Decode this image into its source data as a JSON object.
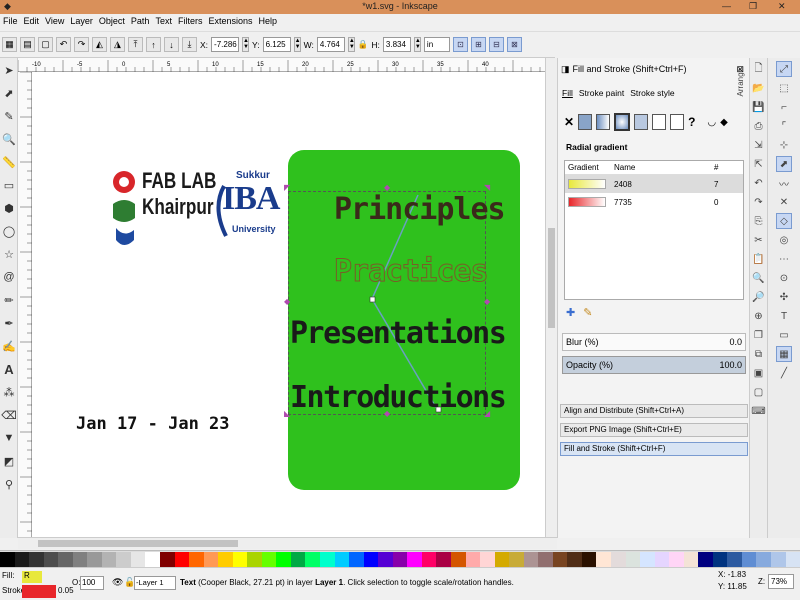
{
  "window": {
    "title": "*w1.svg - Inkscape",
    "minimize": "—",
    "maximize": "❐",
    "close": "✕"
  },
  "menu": [
    "File",
    "Edit",
    "View",
    "Layer",
    "Object",
    "Path",
    "Text",
    "Filters",
    "Extensions",
    "Help"
  ],
  "toolctrl": {
    "x_label": "X:",
    "x": "-7.286",
    "y_label": "Y:",
    "y": "6.125",
    "w_label": "W:",
    "w": "4.764",
    "h_label": "H:",
    "h": "3.834",
    "unit": "in"
  },
  "ruler_ticks": [
    "-10",
    "-5",
    "0",
    "5",
    "10",
    "15",
    "20",
    "25",
    "30",
    "35",
    "40"
  ],
  "canvas": {
    "fablab_line1": "FAB LAB",
    "fablab_line2": "Khairpur",
    "iba_top": "Sukkur",
    "iba_main": "IBA",
    "iba_bottom": "University",
    "date": "Jan 17 - Jan 23",
    "lines": [
      "Principles",
      "Practices",
      "Presentations",
      "Introductions"
    ],
    "box_color": "#2fc11d"
  },
  "dock": {
    "title": "Fill and Stroke (Shift+Ctrl+F)",
    "tabs": [
      "Fill",
      "Stroke paint",
      "Stroke style"
    ],
    "paint_x": "✕",
    "paint_unknown": "?",
    "gradient_type": "Radial gradient",
    "gradient_header_gradient": "Gradient",
    "gradient_header_name": "Name",
    "gradient_header_count": "#",
    "gradients": [
      {
        "name": "2408",
        "count": "7",
        "color": "#e8e83c"
      },
      {
        "name": "7735",
        "count": "0",
        "color": "#e8262a"
      }
    ],
    "blur_label": "Blur (%)",
    "blur_value": "0.0",
    "opacity_label": "Opacity (%)",
    "opacity_value": "100.0",
    "panels": [
      "Align and Distribute (Shift+Ctrl+A)",
      "Export PNG Image (Shift+Ctrl+E)",
      "Fill and Stroke (Shift+Ctrl+F)"
    ],
    "arrange": "Arrange"
  },
  "status": {
    "fill_label": "Fill:",
    "fill_value": "R",
    "stroke_label": "Stroke:",
    "stroke_value": "0.05",
    "opacity_label": "O:",
    "opacity_value": "100",
    "layer": "-Layer 1",
    "message_type": "Text",
    "message": "(Cooper Black, 27.21 pt) in layer",
    "message_layer": "Layer 1",
    "message_end": ". Click selection to toggle scale/rotation handles.",
    "x_label": "X:",
    "x": "-1.83",
    "y_label": "Y:",
    "y": "11.85",
    "zoom_label": "Z:",
    "zoom": "73%"
  },
  "palette_colors": [
    "#000000",
    "#1a1a1a",
    "#333333",
    "#4d4d4d",
    "#666666",
    "#808080",
    "#999999",
    "#b3b3b3",
    "#cccccc",
    "#e6e6e6",
    "#ffffff",
    "#800000",
    "#ff0000",
    "#ff6600",
    "#ff9955",
    "#ffcc00",
    "#ffff00",
    "#aad400",
    "#66ff00",
    "#00ff00",
    "#00aa44",
    "#00ff66",
    "#00ffcc",
    "#00ccff",
    "#0066ff",
    "#0000ff",
    "#5500d4",
    "#8800aa",
    "#ff00ff",
    "#ff0066",
    "#aa0044",
    "#d45500",
    "#ffaaaa",
    "#ffd5d5",
    "#d4aa00",
    "#c8ab37",
    "#ac9393",
    "#916f6f",
    "#784421",
    "#502d16",
    "#2b1100",
    "#ffe6d5",
    "#e3dbdb",
    "#dbe3de",
    "#d5e5ff",
    "#e5d5ff",
    "#ffd5f6",
    "#f4e3d7",
    "#000080",
    "#003380",
    "#2c5aa0",
    "#5f8dd3",
    "#87aade",
    "#afc6e9",
    "#d7e3f4"
  ]
}
